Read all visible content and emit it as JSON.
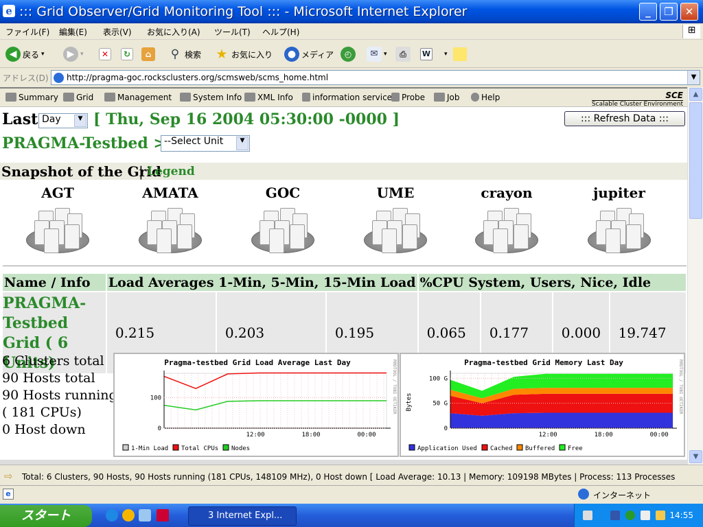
{
  "window": {
    "title": "::: Grid Observer/Grid Monitoring Tool ::: - Microsoft Internet Explorer",
    "btn_min": "_",
    "btn_max": "❐",
    "btn_close": "✕",
    "ie_glyph": "e",
    "win_glyph": "⊞"
  },
  "menu": [
    "ファイル(F)",
    "編集(E)",
    "表示(V)",
    "お気に入り(A)",
    "ツール(T)",
    "ヘルプ(H)"
  ],
  "toolbar": {
    "back": "戻る",
    "search": "検索",
    "favorites": "お気に入り",
    "media": "メディア"
  },
  "address": {
    "label": "アドレス(D)",
    "url": "http://pragma-goc.rocksclusters.org/scmsweb/scms_home.html"
  },
  "nav": [
    "Summary",
    "Grid",
    "Management",
    "System Info",
    "XML Info",
    "information service",
    "Probe",
    "Job",
    "Help"
  ],
  "sce": {
    "short": "SCE",
    "long": "Scalable Cluster Environment"
  },
  "header": {
    "last_label": "Last",
    "period": "Day",
    "datetime": "[ Thu, Sep 16 2004 05:30:00 -0000 ]",
    "refresh": "::: Refresh Data :::",
    "grid_name": "PRAGMA-Testbed >",
    "unit_select": "--Select Unit"
  },
  "snapshot": {
    "title": "Snapshot of the Grid",
    "sep": "|",
    "legend": "Legend"
  },
  "clusters": [
    "AGT",
    "AMATA",
    "GOC",
    "UME",
    "crayon",
    "jupiter"
  ],
  "table": {
    "h_name": "Name / Info",
    "h_load": "Load Averages 1-Min, 5-Min, 15-Min Load",
    "h_cpu": "%CPU System, Users, Nice, Idle",
    "grid_label": "PRAGMA-Testbed Grid ( 6 Units)",
    "loads": [
      "0.215",
      "0.203",
      "0.195"
    ],
    "cpu": [
      "0.065",
      "0.177",
      "0.000",
      "19.747"
    ]
  },
  "info": [
    "6 Clusters total",
    "90 Hosts total",
    "90 Hosts running",
    "( 181 CPUs)",
    "0 Host down"
  ],
  "charts": [
    {
      "title": "Pragma-testbed Grid Load Average Last Day",
      "side": "RRDTOOL / TOBI OETIKER",
      "ylabel": "",
      "yticks": [
        "0",
        "100"
      ],
      "xticks": [
        "12:00",
        "18:00",
        "00:00"
      ],
      "legend": [
        {
          "label": "1-Min Load",
          "color": "#d0d0d0"
        },
        {
          "label": "Total CPUs",
          "color": "#ee1111"
        },
        {
          "label": "Nodes",
          "color": "#22cc22"
        }
      ]
    },
    {
      "title": "Pragma-testbed Grid Memory Last Day",
      "side": "RRDTOOL / TOBI OETIKER",
      "ylabel": "Bytes",
      "yticks": [
        "0",
        "50 G",
        "100 G"
      ],
      "xticks": [
        "12:00",
        "18:00",
        "00:00"
      ],
      "legend": [
        {
          "label": "Application Used",
          "color": "#3333dd"
        },
        {
          "label": "Cached",
          "color": "#ee1111"
        },
        {
          "label": "Buffered",
          "color": "#ff8800"
        },
        {
          "label": "Free",
          "color": "#22ee22"
        }
      ]
    }
  ],
  "chart_data": [
    {
      "type": "line",
      "title": "Pragma-testbed Grid Load Average Last Day",
      "xlabel": "",
      "ylabel": "",
      "x_ticks": [
        "12:00",
        "18:00",
        "00:00"
      ],
      "ylim": [
        0,
        180
      ],
      "series": [
        {
          "name": "1-Min Load",
          "values": [
            0.2,
            0.2,
            0.2,
            0.2,
            0.2,
            0.2,
            0.2,
            0.2
          ]
        },
        {
          "name": "Total CPUs",
          "values": [
            170,
            130,
            178,
            181,
            181,
            181,
            181,
            181
          ]
        },
        {
          "name": "Nodes",
          "values": [
            75,
            60,
            88,
            90,
            90,
            90,
            90,
            90
          ]
        }
      ]
    },
    {
      "type": "area",
      "title": "Pragma-testbed Grid Memory Last Day",
      "xlabel": "",
      "ylabel": "Bytes",
      "x_ticks": [
        "12:00",
        "18:00",
        "00:00"
      ],
      "ylim": [
        0,
        110
      ],
      "stacked": true,
      "series": [
        {
          "name": "Application Used",
          "values": [
            30,
            25,
            30,
            31,
            31,
            31,
            31,
            31
          ]
        },
        {
          "name": "Cached",
          "values": [
            35,
            25,
            37,
            38,
            38,
            38,
            38,
            38
          ]
        },
        {
          "name": "Buffered",
          "values": [
            12,
            10,
            12,
            12,
            12,
            12,
            12,
            12
          ]
        },
        {
          "name": "Free",
          "values": [
            20,
            15,
            24,
            28,
            28,
            28,
            28,
            28
          ]
        }
      ]
    }
  ],
  "status": {
    "arrow": "⇨",
    "summary": "Total: 6 Clusters, 90 Hosts, 90 Hosts running (181 CPUs, 148109 MHz), 0 Host down [ Load Average: 10.13 | Memory: 109198 MBytes | Process: 113 Processes"
  },
  "iestatus": {
    "zone": "インターネット"
  },
  "taskbar": {
    "start": "スタート",
    "item": "3 Internet Expl...",
    "clock": "14:55"
  }
}
